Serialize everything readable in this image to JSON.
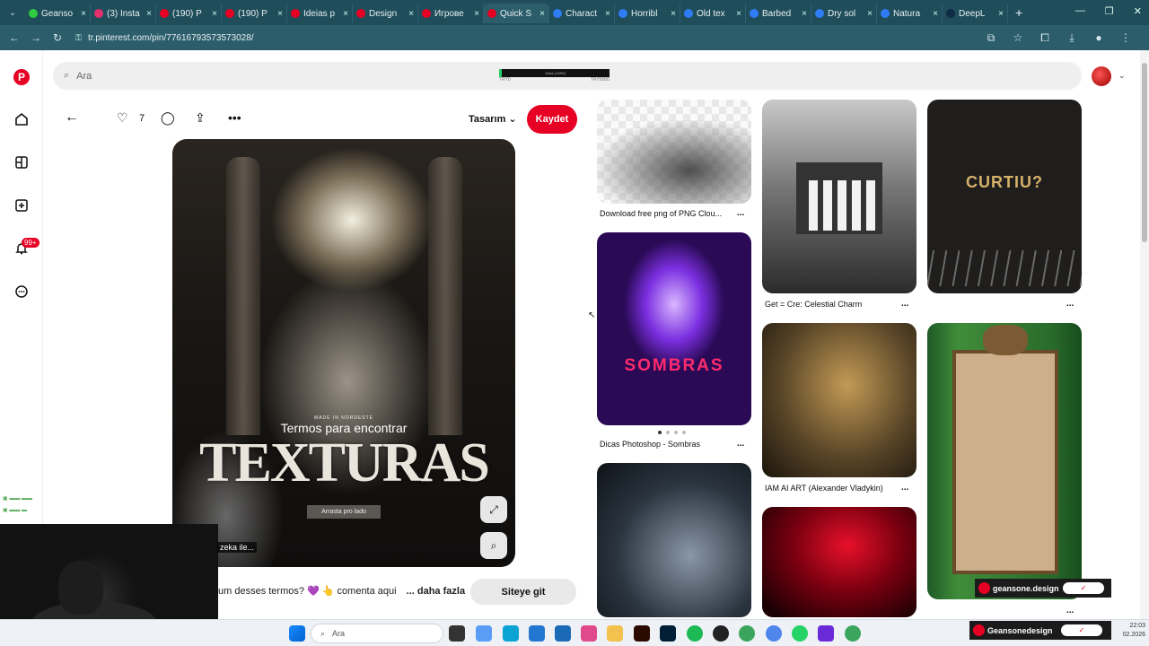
{
  "browser": {
    "tabs": [
      {
        "label": "Geanso",
        "color": "#2ecc40"
      },
      {
        "label": "(3) Insta",
        "color": "#e1306c"
      },
      {
        "label": "(190) P",
        "color": "#e60023"
      },
      {
        "label": "(190) P",
        "color": "#e60023"
      },
      {
        "label": "Ideias p",
        "color": "#e60023"
      },
      {
        "label": "Design",
        "color": "#e60023"
      },
      {
        "label": "Игрове",
        "color": "#e60023"
      },
      {
        "label": "Quick S",
        "color": "#e60023",
        "active": true
      },
      {
        "label": "Charact",
        "color": "#2f7cf6"
      },
      {
        "label": "Horribl",
        "color": "#2f7cf6"
      },
      {
        "label": "Old tex",
        "color": "#2f7cf6"
      },
      {
        "label": "Barbed",
        "color": "#2f7cf6"
      },
      {
        "label": "Dry sol",
        "color": "#2f7cf6"
      },
      {
        "label": "Natura",
        "color": "#2f7cf6"
      },
      {
        "label": "DeepL",
        "color": "#0f2b46"
      }
    ],
    "new_tab": "+",
    "url": "tr.pinterest.com/pin/77616793573573028/"
  },
  "pinterest": {
    "search_placeholder": "Ara",
    "notification_badge": "99+",
    "overlay_bar": {
      "label": "Meta (128%)",
      "left": "TRY0",
      "right": "TRY5000"
    },
    "pin": {
      "like_count": "7",
      "board": "Tasarım",
      "save_label": "Kaydet",
      "poster": {
        "made_in": "MADE IN NORDESTE",
        "title_small": "Termos para encontrar",
        "title_big": "TEXTURAS",
        "cta": "Arrasta pro lado"
      },
      "description_snippet": "um desses termos? 💜 👆 comenta aqui",
      "more_label": "... daha fazla",
      "visit_label": "Siteye git"
    },
    "webcam_tag": "zeka ile...",
    "grid": [
      {
        "caption": "Download free png of PNG Clou...",
        "more": "..."
      },
      {
        "caption": "Get = Cre: Celestial Charm",
        "more": "..."
      },
      {
        "caption": "",
        "more": "..."
      },
      {
        "caption": "Dicas Photoshop - Sombras",
        "more": "..."
      },
      {
        "caption": "IAM AI ART (Alexander Vladykin)",
        "more": "..."
      },
      {
        "caption": "",
        "more": "..."
      }
    ],
    "curtiu_title": "CURTIU?",
    "sombras_title": "SOMBRAS",
    "stream_name": "geansone.design",
    "stream_name2": "Geansonedesign"
  },
  "taskbar": {
    "search": "Ara",
    "time": "22:03",
    "date": "02.2026"
  }
}
